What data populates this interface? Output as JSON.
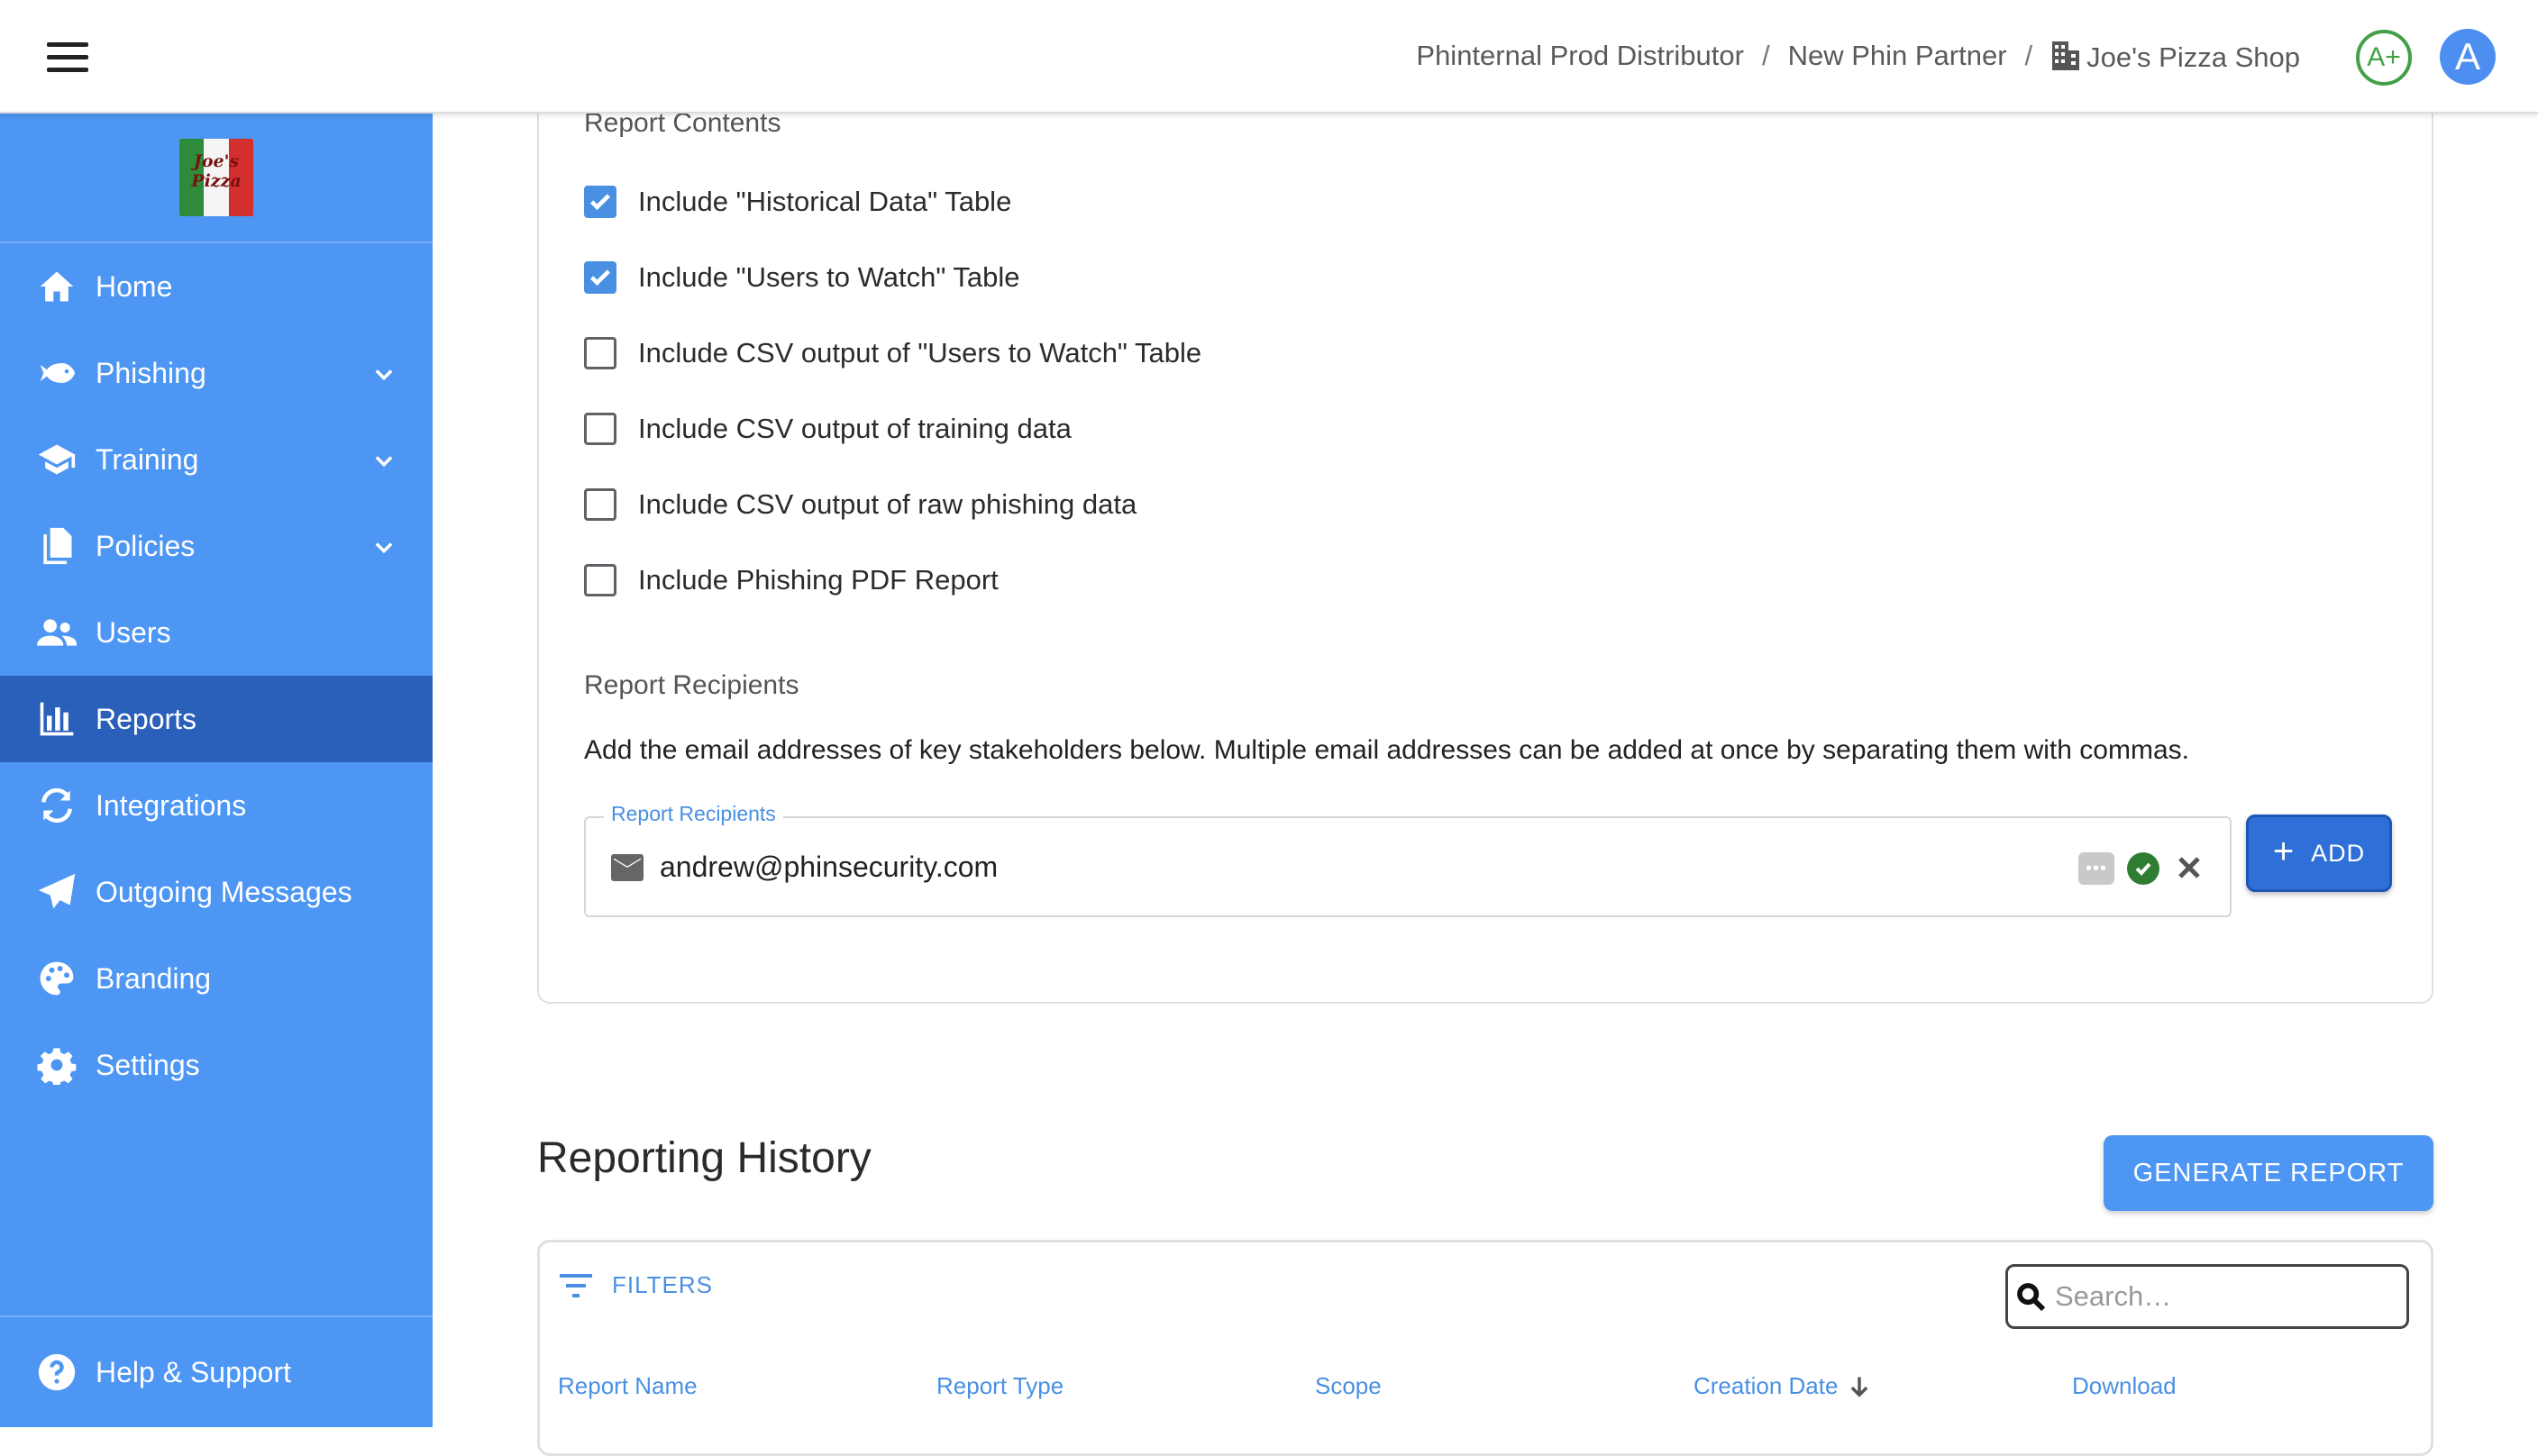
{
  "breadcrumb": {
    "items": [
      "Phinternal Prod Distributor",
      "New Phin Partner",
      "Joe's Pizza Shop"
    ],
    "separator": "/"
  },
  "header": {
    "grade": "A+",
    "avatar_initial": "A"
  },
  "sidebar": {
    "logo_text": "Joe's Pizza",
    "items": [
      {
        "label": "Home",
        "icon": "home-icon"
      },
      {
        "label": "Phishing",
        "icon": "fish-icon",
        "expandable": true
      },
      {
        "label": "Training",
        "icon": "graduation-cap-icon",
        "expandable": true
      },
      {
        "label": "Policies",
        "icon": "documents-icon",
        "expandable": true
      },
      {
        "label": "Users",
        "icon": "users-icon"
      },
      {
        "label": "Reports",
        "icon": "bar-chart-icon",
        "active": true
      },
      {
        "label": "Integrations",
        "icon": "sync-icon"
      },
      {
        "label": "Outgoing Messages",
        "icon": "paper-plane-icon"
      },
      {
        "label": "Branding",
        "icon": "palette-icon"
      },
      {
        "label": "Settings",
        "icon": "gear-icon"
      }
    ],
    "help_label": "Help & Support"
  },
  "report_contents": {
    "title": "Report Contents",
    "options": [
      {
        "label": "Include \"Historical Data\" Table",
        "checked": true
      },
      {
        "label": "Include \"Users to Watch\" Table",
        "checked": true
      },
      {
        "label": "Include CSV output of \"Users to Watch\" Table",
        "checked": false
      },
      {
        "label": "Include CSV output of training data",
        "checked": false
      },
      {
        "label": "Include CSV output of raw phishing data",
        "checked": false
      },
      {
        "label": "Include Phishing PDF Report",
        "checked": false
      }
    ]
  },
  "recipients": {
    "title": "Report Recipients",
    "description": "Add the email addresses of key stakeholders below. Multiple email addresses can be added at once by separating them with commas.",
    "field_label": "Report Recipients",
    "email": "andrew@phinsecurity.com",
    "add_label": "ADD"
  },
  "history": {
    "title": "Reporting History",
    "generate_label": "GENERATE REPORT",
    "filters_label": "FILTERS",
    "search_placeholder": "Search…",
    "columns": [
      "Report Name",
      "Report Type",
      "Scope",
      "Creation Date",
      "Download"
    ],
    "sort_column": "Creation Date",
    "sort_direction": "descending"
  },
  "colors": {
    "sidebar": "#4d96f4",
    "sidebar_active": "#2a5fba",
    "accent": "#4a90e2",
    "success": "#2e7d32"
  }
}
